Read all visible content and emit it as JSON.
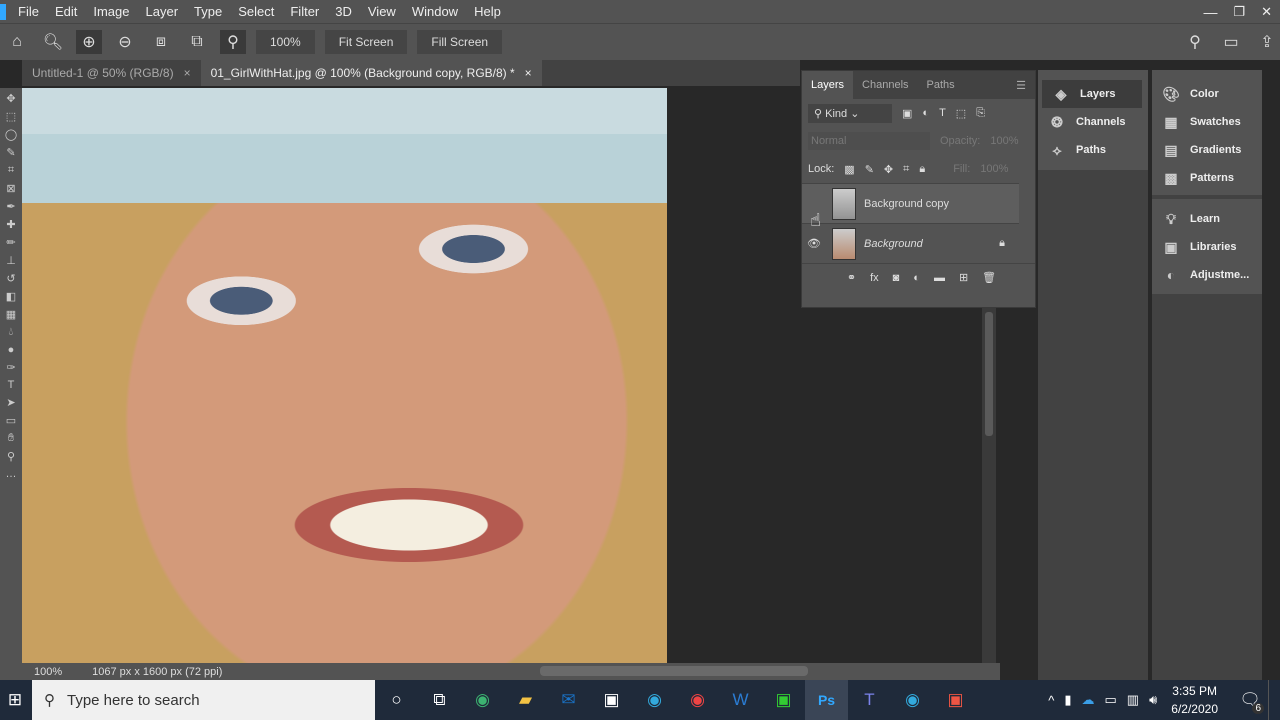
{
  "menu": [
    "File",
    "Edit",
    "Image",
    "Layer",
    "Type",
    "Select",
    "Filter",
    "3D",
    "View",
    "Window",
    "Help"
  ],
  "options": {
    "zoom": "100%",
    "fit_screen": "Fit Screen",
    "fill_screen": "Fill Screen"
  },
  "tabs": [
    {
      "label": "Untitled-1 @ 50% (RGB/8)",
      "close": "×"
    },
    {
      "label": "01_GirlWithHat.jpg @ 100% (Background copy, RGB/8) *",
      "close": "×"
    }
  ],
  "status": {
    "zoom": "100%",
    "doc": "1067 px x 1600 px (72 ppi)"
  },
  "layers_panel": {
    "tabs": [
      "Layers",
      "Channels",
      "Paths"
    ],
    "filter": "Kind",
    "blend": "Normal",
    "opacity_label": "Opacity:",
    "opacity": "100%",
    "lock_label": "Lock:",
    "fill_label": "Fill:",
    "fill": "100%",
    "layers": [
      {
        "name": "Background copy",
        "visible": false,
        "selected": true
      },
      {
        "name": "Background",
        "visible": true,
        "locked": true
      }
    ]
  },
  "dock1": [
    "Layers",
    "Channels",
    "Paths"
  ],
  "dock2a": [
    "Color",
    "Swatches",
    "Gradients",
    "Patterns"
  ],
  "dock2b": [
    "Learn",
    "Libraries",
    "Adjustme..."
  ],
  "taskbar": {
    "search_placeholder": "Type here to search",
    "time": "3:35 PM",
    "date": "6/2/2020",
    "notifications": "6"
  }
}
